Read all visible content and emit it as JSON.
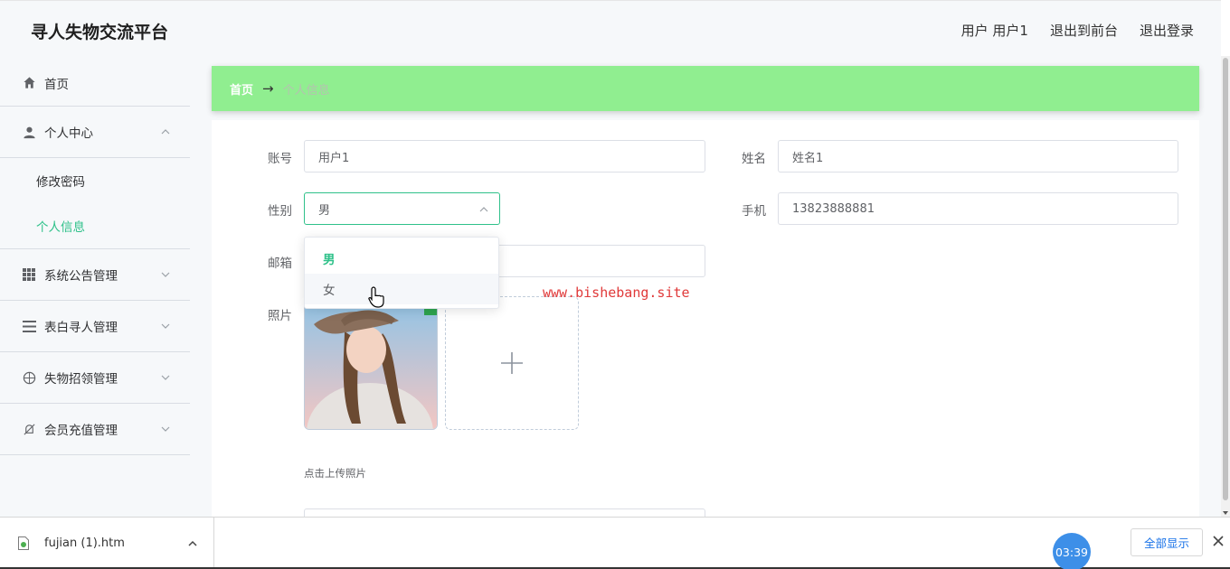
{
  "header": {
    "app_title": "寻人失物交流平台",
    "user_label": "用户 用户1",
    "to_frontend": "退出到前台",
    "logout": "退出登录"
  },
  "sidebar": {
    "items": [
      {
        "label": "首页",
        "icon": "home-icon"
      },
      {
        "label": "个人中心",
        "icon": "user-icon",
        "expanded": true,
        "children": [
          {
            "label": "修改密码"
          },
          {
            "label": "个人信息",
            "active": true
          }
        ]
      },
      {
        "label": "系统公告管理",
        "icon": "grid-icon"
      },
      {
        "label": "表白寻人管理",
        "icon": "list-icon"
      },
      {
        "label": "失物招领管理",
        "icon": "compass-icon"
      },
      {
        "label": "会员充值管理",
        "icon": "bell-off-icon"
      }
    ]
  },
  "breadcrumb": {
    "home": "首页",
    "separator": "→",
    "current": "个人信息"
  },
  "form": {
    "account_label": "账号",
    "account_value": "用户1",
    "name_label": "姓名",
    "name_value": "姓名1",
    "gender_label": "性别",
    "gender_value": "男",
    "phone_label": "手机",
    "phone_value": "13823888881",
    "email_label": "邮箱",
    "photo_label": "照片",
    "upload_tip": "点击上传照片",
    "gender_options": [
      {
        "label": "男",
        "selected": true
      },
      {
        "label": "女",
        "hover": true
      }
    ]
  },
  "watermark": "www.bishebang.site",
  "download_bar": {
    "file_name": "fujian (1).htm",
    "show_all": "全部显示"
  },
  "timer": "03:39",
  "colors": {
    "accent": "#2fc18a",
    "breadcrumb_bg": "#90ee90",
    "link_blue": "#1a73e8"
  }
}
